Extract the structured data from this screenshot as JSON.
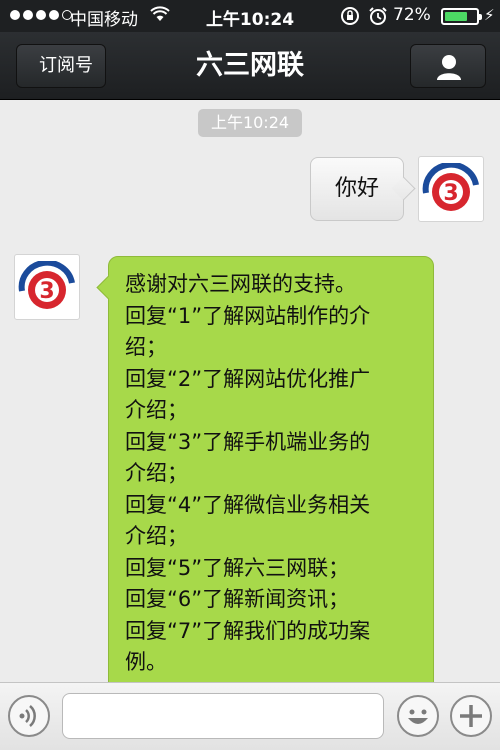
{
  "status_bar": {
    "carrier": "中国移动",
    "time": "上午10:24",
    "battery_percent_label": "72%",
    "battery_level": 0.72,
    "icons": [
      "signal-dots-icon",
      "wifi-icon",
      "rotation-lock-icon",
      "alarm-icon",
      "battery-icon",
      "charging-bolt-icon"
    ]
  },
  "nav": {
    "back_label": "订阅号",
    "title": "六三网联",
    "profile_icon": "person-icon"
  },
  "chat": {
    "timestamp": "上午10:24",
    "messages": [
      {
        "from": "me",
        "text": "你好"
      },
      {
        "from": "account",
        "lines": [
          "感谢对六三网联的支持。",
          "回复“1”了解网站制作的介",
          "绍；",
          "回复“2”了解网站优化推广",
          "介绍；",
          "回复“3”了解手机端业务的",
          "介绍；",
          "回复“4”了解微信业务相关",
          "介绍；",
          "回复“5”了解六三网联；",
          "回复“6”了解新闻资讯；",
          "回复“7”了解我们的成功案",
          "例。"
        ]
      }
    ]
  },
  "input_bar": {
    "value": "",
    "placeholder": "",
    "icons": [
      "voice-icon",
      "emoji-icon",
      "plus-icon"
    ]
  },
  "colors": {
    "incoming_bubble": "#a7d94a",
    "nav_bg": "#1e2022",
    "chat_bg": "#ececec",
    "logo_red": "#d7262e",
    "logo_blue": "#1b4b9b"
  }
}
